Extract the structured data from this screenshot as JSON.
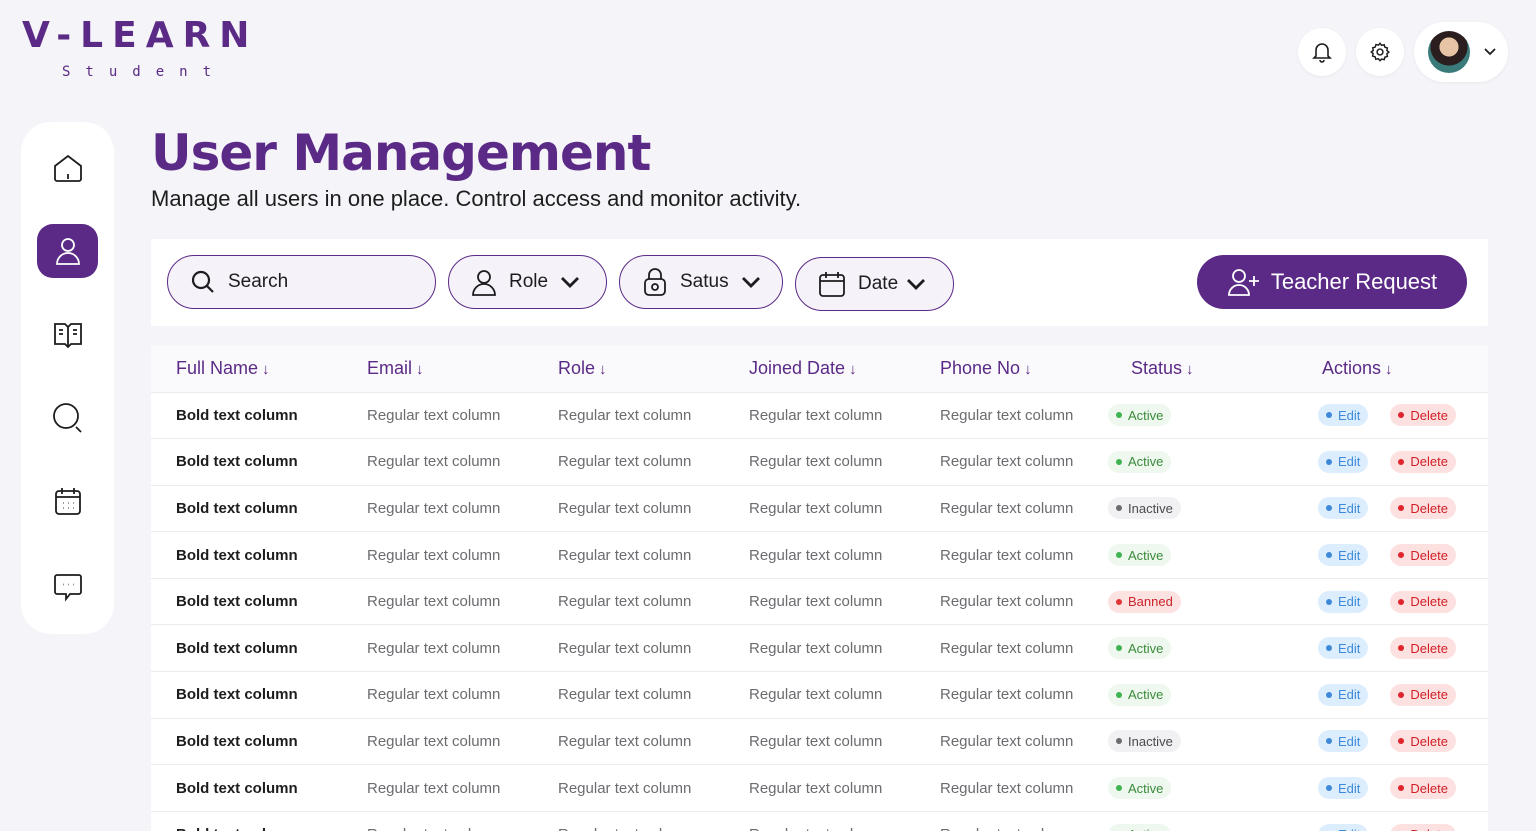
{
  "brand": {
    "title": "V-LEARN",
    "subtitle": "Student"
  },
  "header": {
    "page_title": "User Management",
    "page_subtitle": "Manage all users in one place. Control access and monitor activity."
  },
  "filters": {
    "search_label": "Search",
    "role_label": "Role",
    "status_label": "Satus",
    "date_label": "Date",
    "teacher_request_label": "Teacher Request"
  },
  "table": {
    "columns": [
      "Full Name",
      "Email",
      "Role",
      "Joined Date",
      "Phone No",
      "Status",
      "Actions"
    ],
    "edit_label": "Edit",
    "delete_label": "Delete",
    "rows": [
      {
        "name": "Bold text column",
        "email": "Regular text column",
        "role": "Regular text column",
        "joined": "Regular text column",
        "phone": "Regular text column",
        "status": "Active"
      },
      {
        "name": "Bold text column",
        "email": "Regular text column",
        "role": "Regular text column",
        "joined": "Regular text column",
        "phone": "Regular text column",
        "status": "Active"
      },
      {
        "name": "Bold text column",
        "email": "Regular text column",
        "role": "Regular text column",
        "joined": "Regular text column",
        "phone": "Regular text column",
        "status": "Inactive"
      },
      {
        "name": "Bold text column",
        "email": "Regular text column",
        "role": "Regular text column",
        "joined": "Regular text column",
        "phone": "Regular text column",
        "status": "Active"
      },
      {
        "name": "Bold text column",
        "email": "Regular text column",
        "role": "Regular text column",
        "joined": "Regular text column",
        "phone": "Regular text column",
        "status": "Banned"
      },
      {
        "name": "Bold text column",
        "email": "Regular text column",
        "role": "Regular text column",
        "joined": "Regular text column",
        "phone": "Regular text column",
        "status": "Active"
      },
      {
        "name": "Bold text column",
        "email": "Regular text column",
        "role": "Regular text column",
        "joined": "Regular text column",
        "phone": "Regular text column",
        "status": "Active"
      },
      {
        "name": "Bold text column",
        "email": "Regular text column",
        "role": "Regular text column",
        "joined": "Regular text column",
        "phone": "Regular text column",
        "status": "Inactive"
      },
      {
        "name": "Bold text column",
        "email": "Regular text column",
        "role": "Regular text column",
        "joined": "Regular text column",
        "phone": "Regular text column",
        "status": "Active"
      },
      {
        "name": "Bold text column",
        "email": "Regular text column",
        "role": "Regular text column",
        "joined": "Regular text column",
        "phone": "Regular text column",
        "status": "Active"
      }
    ]
  },
  "colors": {
    "brand": "#5b2a86",
    "background": "#f5f4f8",
    "active": "#3fb34f",
    "banned": "#e23434",
    "edit": "#3f8ad8"
  },
  "icons": {
    "sidebar": [
      "home-icon",
      "user-icon",
      "book-icon",
      "search-icon",
      "calendar-icon",
      "chat-icon"
    ],
    "top": [
      "bell-icon",
      "gear-icon",
      "avatar",
      "chevron-down-icon"
    ]
  }
}
